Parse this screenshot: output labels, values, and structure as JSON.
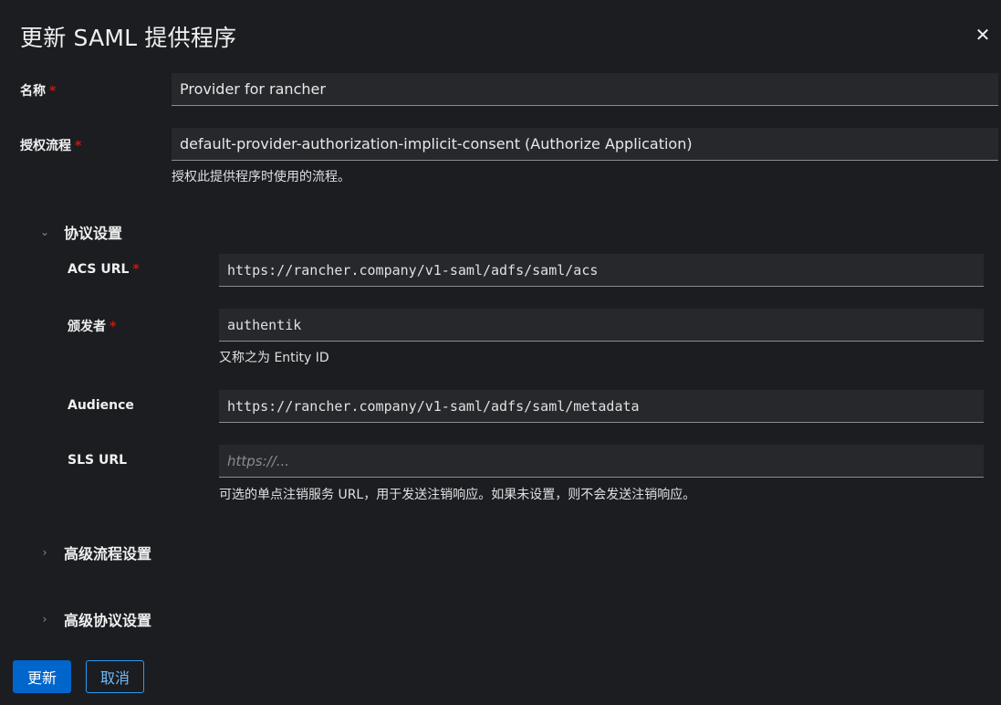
{
  "dialog": {
    "title": "更新 SAML 提供程序",
    "close_icon": "close-icon"
  },
  "form": {
    "name": {
      "label": "名称",
      "required_mark": "*",
      "value": "Provider for rancher"
    },
    "auth_flow": {
      "label": "授权流程",
      "required_mark": "*",
      "value": "default-provider-authorization-implicit-consent (Authorize Application)",
      "help": "授权此提供程序时使用的流程。"
    },
    "protocol_settings": {
      "title": "协议设置",
      "expanded": true,
      "acs_url": {
        "label": "ACS URL",
        "required_mark": "*",
        "value": "https://rancher.company/v1-saml/adfs/saml/acs"
      },
      "issuer": {
        "label": "颁发者",
        "required_mark": "*",
        "value": "authentik",
        "help": "又称之为 Entity ID"
      },
      "audience": {
        "label": "Audience",
        "value": "https://rancher.company/v1-saml/adfs/saml/metadata"
      },
      "sls_url": {
        "label": "SLS URL",
        "value": "",
        "placeholder": "https://...",
        "help": "可选的单点注销服务 URL，用于发送注销响应。如果未设置，则不会发送注销响应。"
      }
    },
    "advanced_flow_settings": {
      "title": "高级流程设置",
      "expanded": false
    },
    "advanced_protocol_settings": {
      "title": "高级协议设置",
      "expanded": false
    }
  },
  "actions": {
    "update_label": "更新",
    "cancel_label": "取消"
  },
  "colors": {
    "background": "#1b1d21",
    "field_bg": "#26282c",
    "primary": "#0066cc",
    "required": "#c9190b",
    "link": "#73bcf7"
  }
}
